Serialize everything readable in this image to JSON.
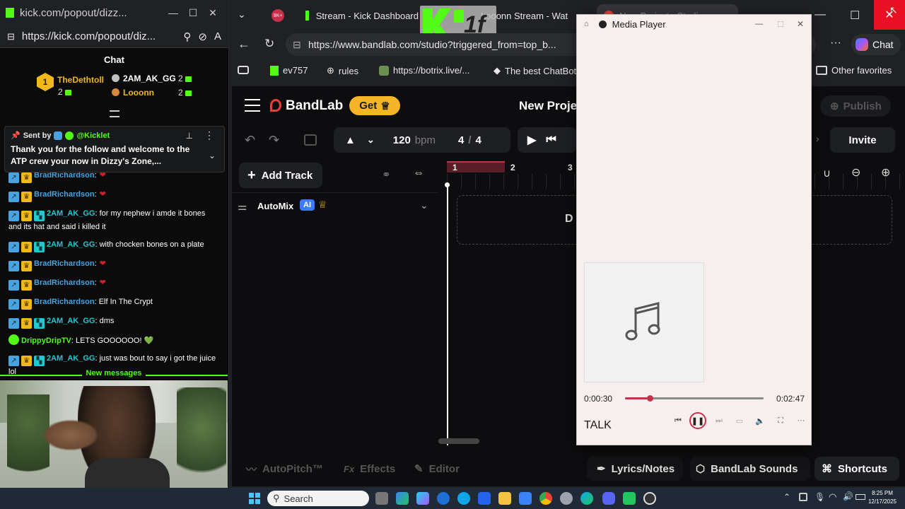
{
  "popout": {
    "title": "kick.com/popout/dizz...",
    "url": "https://kick.com/popout/diz...",
    "chat_header": "Chat",
    "leaderboard": [
      {
        "rank": "1",
        "name": "TheDethtoll",
        "count": "2",
        "color": "#f0b81a"
      },
      {
        "name": "2AM_AK_GG",
        "count": "2",
        "color": "#ffffff"
      },
      {
        "name": "Looonn",
        "count": "2",
        "color": "#f0b81a"
      }
    ],
    "pinned": {
      "sent_by_label": "Sent by",
      "sender": "@Kicklet",
      "message": "Thank you for the follow and welcome to the ATP crew your now in Dizzy's Zone,..."
    },
    "messages": [
      {
        "user": "BradRichardson",
        "text": ":",
        "color": "#4aa3df",
        "badges": [
          "blue",
          "gold"
        ],
        "emote": "heart"
      },
      {
        "user": "BradRichardson",
        "text": ":",
        "color": "#4aa3df",
        "badges": [
          "blue",
          "gold"
        ],
        "emote": "heart"
      },
      {
        "user": "2AM_AK_GG",
        "text": ": for my nephew i amde it bones and its hat and said i killed it",
        "color": "#21c8d2",
        "badges": [
          "blue",
          "gold",
          "teal"
        ]
      },
      {
        "user": "2AM_AK_GG",
        "text": ": with chocken bones on a plate",
        "color": "#21c8d2",
        "badges": [
          "blue",
          "gold",
          "teal"
        ]
      },
      {
        "user": "BradRichardson",
        "text": ":",
        "color": "#4aa3df",
        "badges": [
          "blue",
          "gold"
        ],
        "emote": "heart"
      },
      {
        "user": "BradRichardson",
        "text": ":",
        "color": "#4aa3df",
        "badges": [
          "blue",
          "gold"
        ],
        "emote": "heart"
      },
      {
        "user": "BradRichardson",
        "text": ": Elf In The Crypt",
        "color": "#4aa3df",
        "badges": [
          "blue",
          "gold"
        ]
      },
      {
        "user": "2AM_AK_GG",
        "text": ": dms",
        "color": "#21c8d2",
        "badges": [
          "blue",
          "gold",
          "teal"
        ]
      },
      {
        "user": "DrippyDripTV",
        "text": ": LETS GOOOOOO! 💚",
        "color": "#53fc18",
        "badges": [
          "verified"
        ]
      },
      {
        "user": "2AM_AK_GG",
        "text": ": just was bout to say i got the juice lol",
        "color": "#21c8d2",
        "badges": [
          "blue",
          "gold",
          "teal"
        ]
      }
    ],
    "new_messages": "New messages"
  },
  "browser": {
    "tabs": [
      {
        "label": "Stream - Kick Dashboard"
      },
      {
        "label": "Looonn Stream - Wat"
      },
      {
        "label": "New Project - Studio"
      }
    ],
    "badge_count": "9K+",
    "url": "https://www.bandlab.com/studio?triggered_from=top_b...",
    "chat_button": "Chat",
    "bookmarks": [
      {
        "label": "ev757"
      },
      {
        "label": "rules"
      },
      {
        "label": "https://botrix.live/..."
      },
      {
        "label": "The best ChatBot"
      }
    ],
    "other_favorites": "Other favorites"
  },
  "bandlab": {
    "logo": "BandLab",
    "get_button": "Get",
    "project_title": "New Projec",
    "publish": "Publish",
    "invite": "Invite",
    "tempo": "120",
    "tempo_unit": "bpm",
    "time_sig_num": "4",
    "time_sig_sep": "/",
    "time_sig_den": "4",
    "add_track": "Add Track",
    "automix": "AutoMix",
    "ai_badge": "AI",
    "ruler": [
      "1",
      "2",
      "3"
    ],
    "drop_hint": "D",
    "bottom": {
      "autopitch": "AutoPitch™",
      "effects": "Effects",
      "fx": "Fx",
      "editor": "Editor",
      "lyrics": "Lyrics/Notes",
      "sounds": "BandLab Sounds",
      "shortcuts": "Shortcuts"
    }
  },
  "media_player": {
    "title": "Media Player",
    "elapsed": "0:00:30",
    "total": "0:02:47",
    "progress_fraction": 0.18,
    "track": "TALK"
  },
  "taskbar": {
    "search": "Search",
    "time": "8:25 PM",
    "date": "12/17/2025"
  },
  "overlay_text": "1f"
}
